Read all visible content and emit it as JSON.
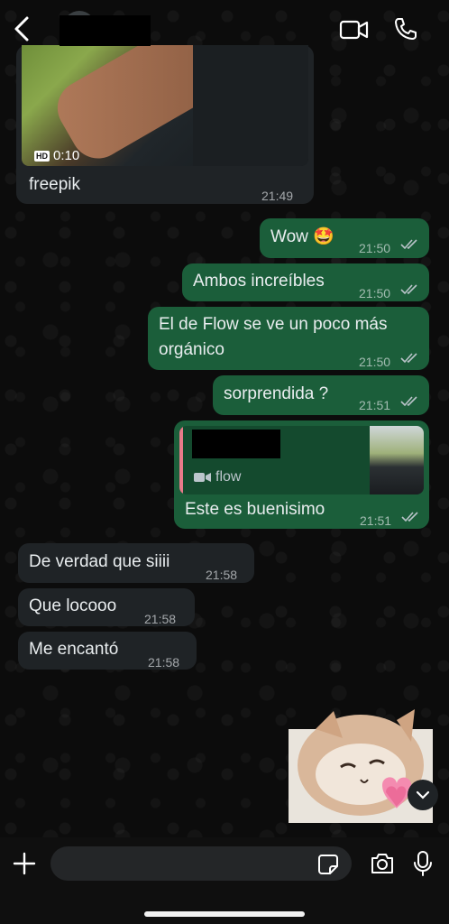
{
  "header": {
    "back_icon": "chevron-left-icon",
    "video_icon": "video-camera-icon",
    "call_icon": "phone-icon"
  },
  "messages": [
    {
      "type": "media",
      "direction": "in",
      "caption": "freepik",
      "duration": "0:10",
      "hd": "HD",
      "time": "21:49"
    },
    {
      "direction": "out",
      "text": "Wow 🤩",
      "time": "21:50",
      "status": "read"
    },
    {
      "direction": "out",
      "text": "Ambos increíbles",
      "time": "21:50",
      "status": "read"
    },
    {
      "direction": "out",
      "text_line1": "El de Flow se ve un poco más",
      "text_line2": "orgánico",
      "time": "21:50",
      "status": "read"
    },
    {
      "direction": "out",
      "text": "sorprendida ?",
      "time": "21:51",
      "status": "read"
    },
    {
      "direction": "out",
      "reply_label": "flow",
      "text": "Este es buenisimo",
      "time": "21:51",
      "status": "read"
    },
    {
      "direction": "in",
      "text": "De verdad que siiii",
      "time": "21:58"
    },
    {
      "direction": "in",
      "text": "Que locooo",
      "time": "21:58"
    },
    {
      "direction": "in",
      "text": "Me encantó",
      "time": "21:58"
    }
  ],
  "colors": {
    "outgoing": "#1b5e3a",
    "incoming": "#1f2326",
    "reply_accent": "#e97a8a"
  },
  "input": {
    "value": "",
    "placeholder": ""
  }
}
